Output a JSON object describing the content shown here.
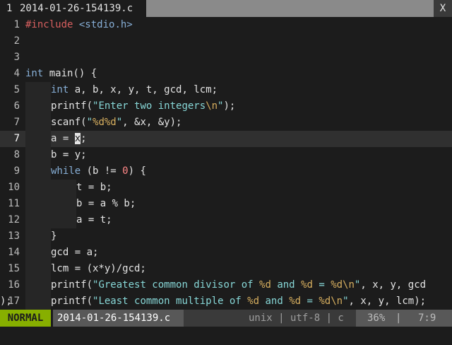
{
  "tabline": {
    "tab_number": "1",
    "tab_name": "2014-01-26-154139.c",
    "close_label": "X"
  },
  "editor": {
    "lines": [
      {
        "num": "1"
      },
      {
        "num": "2"
      },
      {
        "num": "3"
      },
      {
        "num": "4"
      },
      {
        "num": "5"
      },
      {
        "num": "6"
      },
      {
        "num": "7"
      },
      {
        "num": "8"
      },
      {
        "num": "9"
      },
      {
        "num": "10"
      },
      {
        "num": "11"
      },
      {
        "num": "12"
      },
      {
        "num": "13"
      },
      {
        "num": "14"
      },
      {
        "num": "15"
      },
      {
        "num": "16"
      },
      {
        "num": ""
      },
      {
        "num": "17"
      }
    ],
    "code": {
      "l1_pre": "#include",
      "l1_inc": "<stdio.h>",
      "l3_kw": "int",
      "l3_rest": " main() {",
      "l4_kw": "int",
      "l4_rest": " a, b, x, y, t, gcd, lcm;",
      "l5_a": "printf(",
      "l5_str": "\"Enter two integers",
      "l5_fmt": "\\n",
      "l5_str2": "\"",
      "l5_b": ");",
      "l6_a": "scanf(",
      "l6_str": "\"",
      "l6_fmt": "%d%d",
      "l6_str2": "\"",
      "l6_b": ", &x, &y);",
      "l7_a": "a = ",
      "l7_cur": "x",
      "l7_b": ";",
      "l8": "b = y;",
      "l9_kw": "while",
      "l9_a": " (b != ",
      "l9_num": "0",
      "l9_b": ") {",
      "l10": "t = b;",
      "l11": "b = a % b;",
      "l12": "a = t;",
      "l13": "}",
      "l14": "gcd = a;",
      "l15": "lcm = (x*y)/gcd;",
      "l16_a": "printf(",
      "l16_s1": "\"Greatest common divisor of ",
      "l16_f1": "%d",
      "l16_s2": " and ",
      "l16_f2": "%d",
      "l16_s3": " = ",
      "l16_f3": "%d\\n",
      "l16_s4": "\"",
      "l16_b": ", x, y, gcd",
      "l16_wrap": ");",
      "l17_a": "printf(",
      "l17_s1": "\"Least common multiple of ",
      "l17_f1": "%d",
      "l17_s2": " and ",
      "l17_f2": "%d",
      "l17_s3": " = ",
      "l17_f3": "%d\\n",
      "l17_s4": "\"",
      "l17_b": ", x, y, lcm);"
    }
  },
  "statusline": {
    "mode": "NORMAL",
    "filename": "2014-01-26-154139.c",
    "info": "unix | utf-8 | c",
    "percent": "36%",
    "separator": "|",
    "position": "7:9"
  },
  "colors": {
    "mode_bg": "#87af00",
    "keyword": "#87afd7",
    "preproc": "#d75f5f",
    "string": "#87d7d7",
    "format": "#d7af5f",
    "number": "#ff8787"
  }
}
